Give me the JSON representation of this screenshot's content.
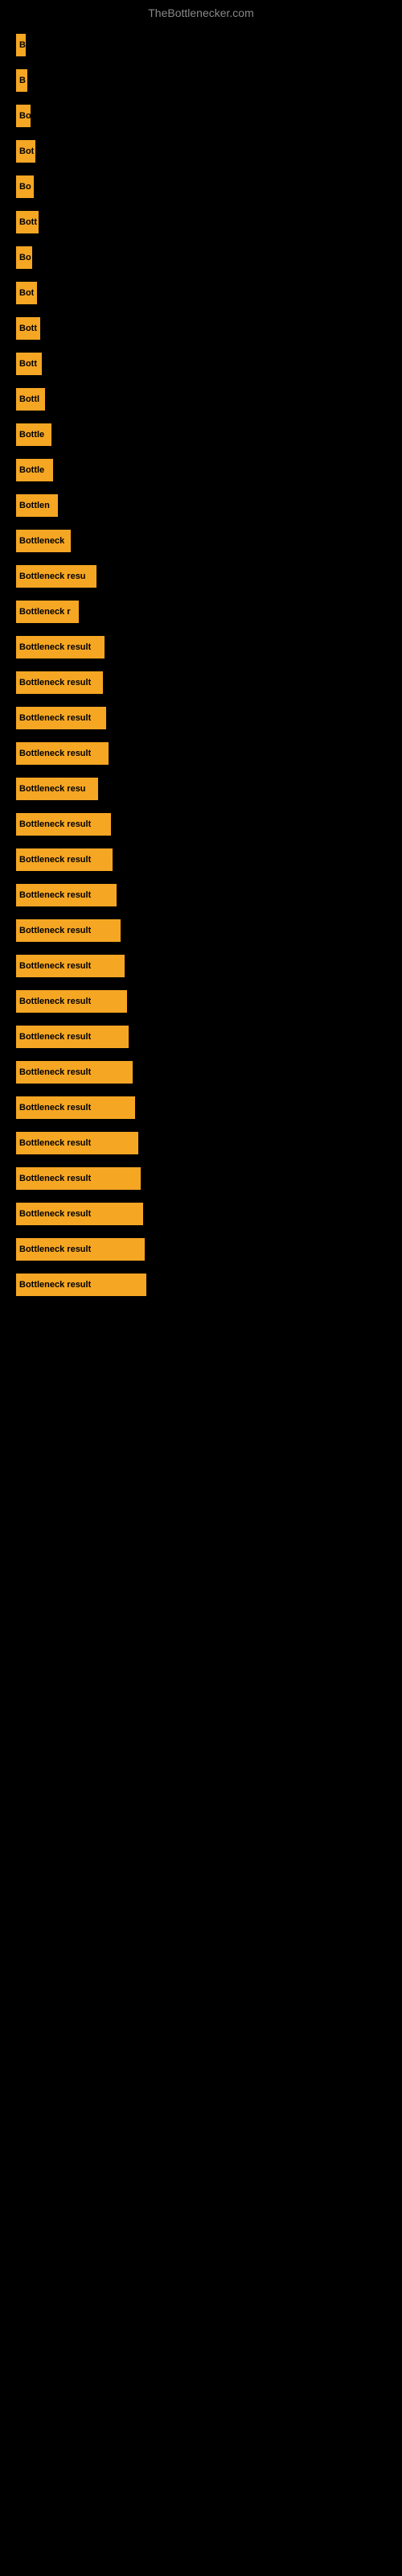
{
  "site": {
    "title": "TheBottlenecker.com"
  },
  "bars": [
    {
      "label": "B",
      "width": 12
    },
    {
      "label": "B‌",
      "width": 14
    },
    {
      "label": "Bo",
      "width": 18
    },
    {
      "label": "Bot",
      "width": 24
    },
    {
      "label": "Bo",
      "width": 22
    },
    {
      "label": "Bott",
      "width": 28
    },
    {
      "label": "Bo",
      "width": 20
    },
    {
      "label": "Bot",
      "width": 26
    },
    {
      "label": "Bott",
      "width": 30
    },
    {
      "label": "Bott",
      "width": 32
    },
    {
      "label": "Bottl",
      "width": 36
    },
    {
      "label": "Bottle",
      "width": 44
    },
    {
      "label": "Bottle",
      "width": 46
    },
    {
      "label": "Bottlen",
      "width": 52
    },
    {
      "label": "Bottleneck",
      "width": 68
    },
    {
      "label": "Bottleneck resu",
      "width": 100
    },
    {
      "label": "Bottleneck r",
      "width": 78
    },
    {
      "label": "Bottleneck result",
      "width": 110
    },
    {
      "label": "Bottleneck result",
      "width": 108
    },
    {
      "label": "Bottleneck result",
      "width": 112
    },
    {
      "label": "Bottleneck result",
      "width": 115
    },
    {
      "label": "Bottleneck resu",
      "width": 102
    },
    {
      "label": "Bottleneck result",
      "width": 118
    },
    {
      "label": "Bottleneck result",
      "width": 120
    },
    {
      "label": "Bottleneck result",
      "width": 125
    },
    {
      "label": "Bottleneck result",
      "width": 130
    },
    {
      "label": "Bottleneck result",
      "width": 135
    },
    {
      "label": "Bottleneck result",
      "width": 138
    },
    {
      "label": "Bottleneck result",
      "width": 140
    },
    {
      "label": "Bottleneck result",
      "width": 145
    },
    {
      "label": "Bottleneck result",
      "width": 148
    },
    {
      "label": "Bottleneck result",
      "width": 152
    },
    {
      "label": "Bottleneck result",
      "width": 155
    },
    {
      "label": "Bottleneck result",
      "width": 158
    },
    {
      "label": "Bottleneck result",
      "width": 160
    },
    {
      "label": "Bottleneck result",
      "width": 162
    }
  ]
}
